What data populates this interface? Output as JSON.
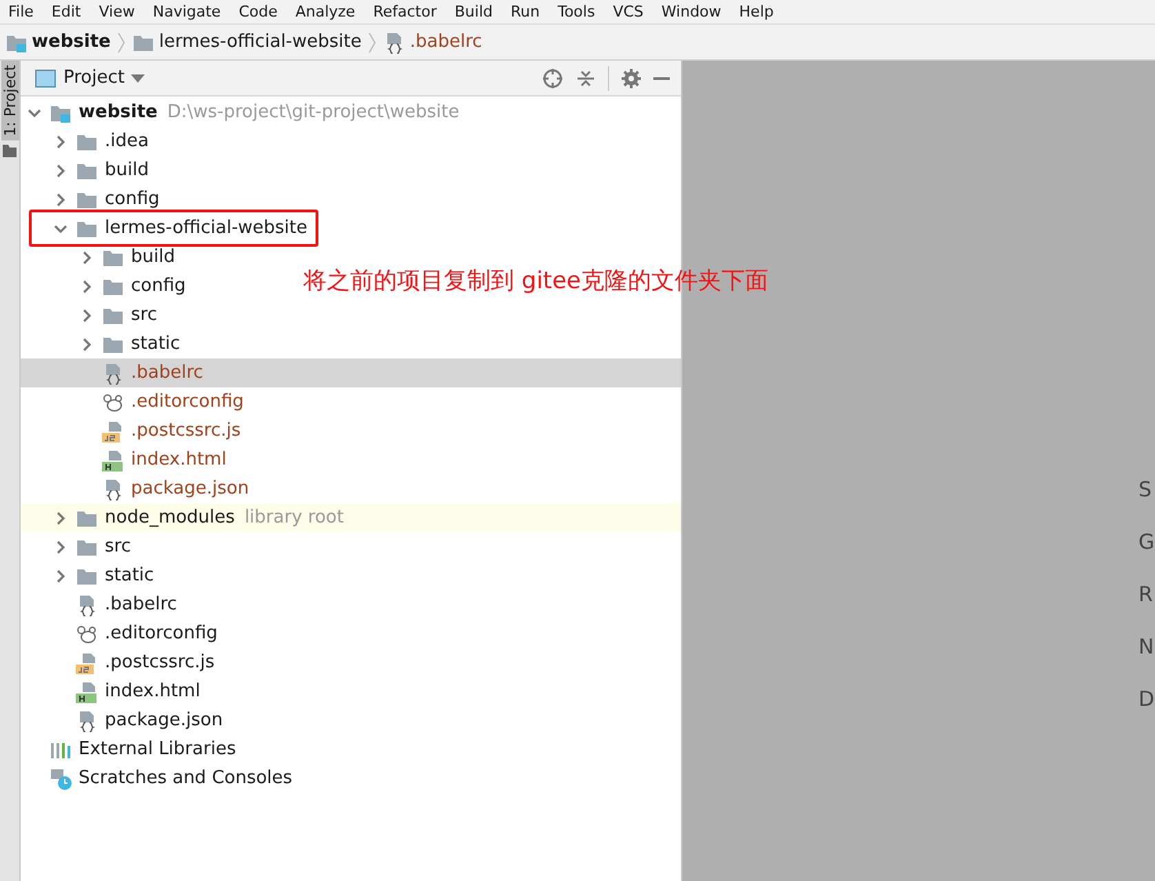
{
  "menu_bar": [
    "File",
    "Edit",
    "View",
    "Navigate",
    "Code",
    "Analyze",
    "Refactor",
    "Build",
    "Run",
    "Tools",
    "VCS",
    "Window",
    "Help"
  ],
  "breadcrumbs": [
    {
      "label": "website",
      "kind": "module",
      "unversioned": false
    },
    {
      "label": "lermes-official-website",
      "kind": "folder",
      "unversioned": false
    },
    {
      "label": ".babelrc",
      "kind": "json",
      "unversioned": true
    }
  ],
  "tool_stripe": {
    "tab": "1: Project",
    "selected": true
  },
  "project_panel": {
    "title": "Project"
  },
  "tree": [
    {
      "label": "website",
      "path": "D:\\ws-project\\git-project\\website",
      "kind": "module",
      "expanded": true,
      "selected": false,
      "unversioned": false,
      "children": [
        {
          "label": ".idea",
          "kind": "folder",
          "expanded": false,
          "selected": false,
          "unversioned": false
        },
        {
          "label": "build",
          "kind": "folder",
          "expanded": false,
          "selected": false,
          "unversioned": false
        },
        {
          "label": "config",
          "kind": "folder",
          "expanded": false,
          "selected": false,
          "unversioned": false
        },
        {
          "label": "lermes-official-website",
          "kind": "folder",
          "expanded": true,
          "selected": false,
          "unversioned": false,
          "annotated": true,
          "children": [
            {
              "label": "build",
              "kind": "folder",
              "expanded": false,
              "selected": false,
              "unversioned": false
            },
            {
              "label": "config",
              "kind": "folder",
              "expanded": false,
              "selected": false,
              "unversioned": false
            },
            {
              "label": "src",
              "kind": "folder",
              "expanded": false,
              "selected": false,
              "unversioned": false
            },
            {
              "label": "static",
              "kind": "folder",
              "expanded": false,
              "selected": false,
              "unversioned": false
            },
            {
              "label": ".babelrc",
              "kind": "json",
              "selected": true,
              "unversioned": true
            },
            {
              "label": ".editorconfig",
              "kind": "editorconfig",
              "selected": false,
              "unversioned": true
            },
            {
              "label": ".postcssrc.js",
              "kind": "js",
              "selected": false,
              "unversioned": true
            },
            {
              "label": "index.html",
              "kind": "html",
              "selected": false,
              "unversioned": true
            },
            {
              "label": "package.json",
              "kind": "json",
              "selected": false,
              "unversioned": true
            }
          ]
        },
        {
          "label": "node_modules",
          "note": "library root",
          "kind": "folder",
          "expanded": false,
          "selected": false,
          "unversioned": false
        },
        {
          "label": "src",
          "kind": "folder",
          "expanded": false,
          "selected": false,
          "unversioned": false
        },
        {
          "label": "static",
          "kind": "folder",
          "expanded": false,
          "selected": false,
          "unversioned": false
        },
        {
          "label": ".babelrc",
          "kind": "json",
          "selected": false,
          "unversioned": false
        },
        {
          "label": ".editorconfig",
          "kind": "editorconfig",
          "selected": false,
          "unversioned": false
        },
        {
          "label": ".postcssrc.js",
          "kind": "js",
          "selected": false,
          "unversioned": false
        },
        {
          "label": "index.html",
          "kind": "html",
          "selected": false,
          "unversioned": false
        },
        {
          "label": "package.json",
          "kind": "json",
          "selected": false,
          "unversioned": false
        }
      ]
    },
    {
      "label": "External Libraries",
      "kind": "libraries",
      "selected": false,
      "unversioned": false
    },
    {
      "label": "Scratches and Consoles",
      "kind": "scratches",
      "selected": false,
      "unversioned": false
    }
  ],
  "annotation": {
    "text": "将之前的项目复制到 gitee克隆的文件夹下面"
  },
  "editor_hints": [
    "S",
    "G",
    "R",
    "N",
    "D"
  ]
}
